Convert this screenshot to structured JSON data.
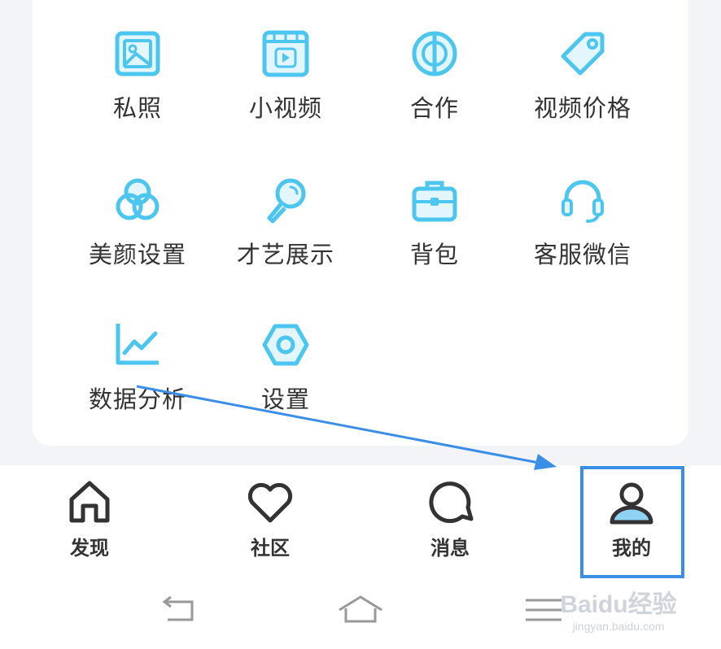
{
  "grid": {
    "items": [
      {
        "label": "私照",
        "icon": "photo-icon"
      },
      {
        "label": "小视频",
        "icon": "video-icon"
      },
      {
        "label": "合作",
        "icon": "cooperation-icon"
      },
      {
        "label": "视频价格",
        "icon": "price-tag-icon"
      },
      {
        "label": "美颜设置",
        "icon": "beauty-icon"
      },
      {
        "label": "才艺展示",
        "icon": "microphone-icon"
      },
      {
        "label": "背包",
        "icon": "briefcase-icon"
      },
      {
        "label": "客服微信",
        "icon": "headset-icon"
      },
      {
        "label": "数据分析",
        "icon": "line-chart-icon"
      },
      {
        "label": "设置",
        "icon": "hexagon-settings-icon"
      }
    ]
  },
  "tabbar": {
    "tabs": [
      {
        "label": "发现",
        "icon": "home-icon"
      },
      {
        "label": "社区",
        "icon": "heart-icon"
      },
      {
        "label": "消息",
        "icon": "chat-bubble-icon"
      },
      {
        "label": "我的",
        "icon": "user-icon",
        "active": true
      }
    ]
  },
  "watermark": {
    "brand": "Baidu经验",
    "url": "jingyan.baidu.com"
  },
  "colors": {
    "icon_blue": "#4cc6ef",
    "icon_blue_fill": "#e3f6fd",
    "text": "#333333",
    "highlight": "#3a8ee6",
    "active_fill": "#8fd3f4"
  }
}
